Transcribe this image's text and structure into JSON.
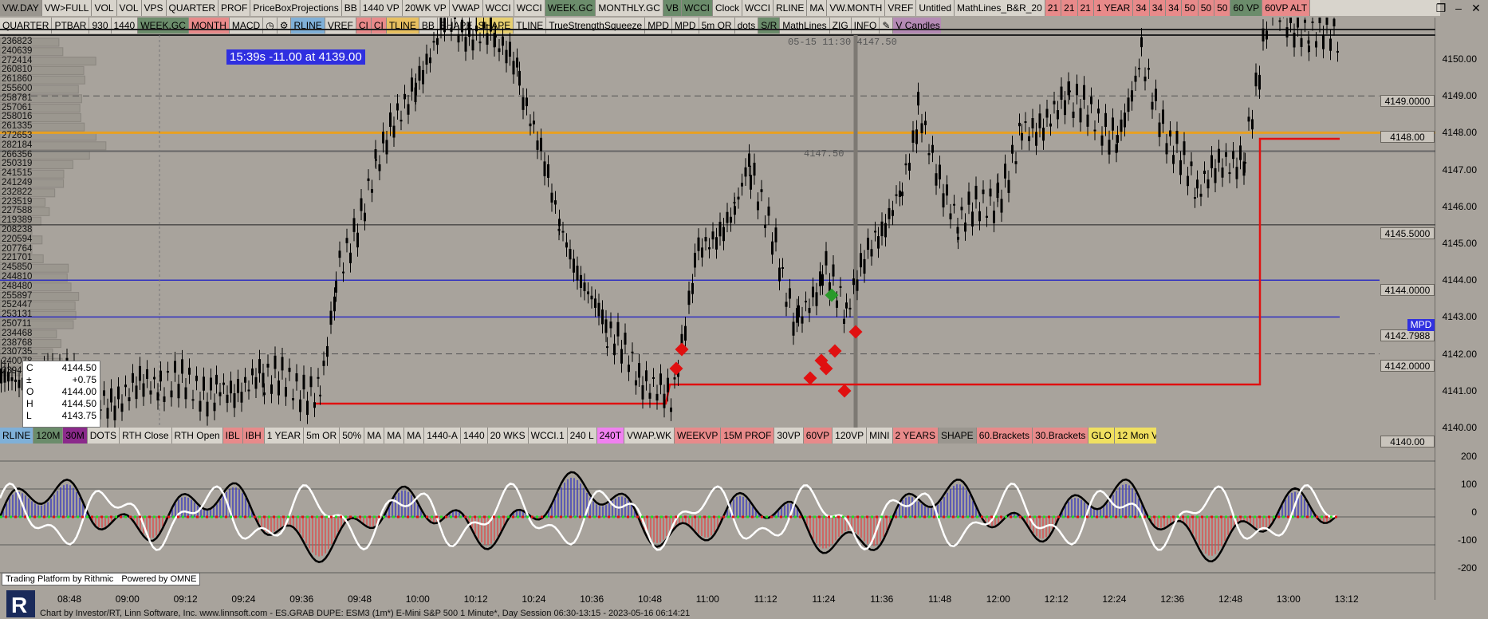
{
  "toolbar1": [
    {
      "label": "VW.DAY",
      "bg": "#9a968f"
    },
    {
      "label": "VW>FULL",
      "bg": "#d8d4cc"
    },
    {
      "label": "VOL",
      "bg": "#d8d4cc"
    },
    {
      "label": "VOL",
      "bg": "#d8d4cc"
    },
    {
      "label": "VPS",
      "bg": "#d8d4cc"
    },
    {
      "label": "QUARTER",
      "bg": "#d8d4cc"
    },
    {
      "label": "PROF",
      "bg": "#d8d4cc"
    },
    {
      "label": "PriceBoxProjections",
      "bg": "#d8d4cc"
    },
    {
      "label": "BB",
      "bg": "#d8d4cc"
    },
    {
      "label": "1440 VP",
      "bg": "#d8d4cc"
    },
    {
      "label": "20WK VP",
      "bg": "#d8d4cc"
    },
    {
      "label": "VWAP",
      "bg": "#d8d4cc"
    },
    {
      "label": "WCCI",
      "bg": "#d8d4cc"
    },
    {
      "label": "WCCI",
      "bg": "#d8d4cc"
    },
    {
      "label": "WEEK.GC",
      "bg": "#6b8c6b"
    },
    {
      "label": "MONTHLY.GC",
      "bg": "#d8d4cc"
    },
    {
      "label": "VB",
      "bg": "#6b8c6b"
    },
    {
      "label": "WCCI",
      "bg": "#6b8c6b"
    },
    {
      "label": "Clock",
      "bg": "#d8d4cc"
    },
    {
      "label": "WCCI",
      "bg": "#d8d4cc"
    },
    {
      "label": "RLINE",
      "bg": "#d8d4cc"
    },
    {
      "label": "MA",
      "bg": "#d8d4cc"
    },
    {
      "label": "VW.MONTH",
      "bg": "#d8d4cc"
    },
    {
      "label": "VREF",
      "bg": "#d8d4cc"
    },
    {
      "label": "Untitled",
      "bg": "#d8d4cc"
    },
    {
      "label": "MathLines_B&R_20",
      "bg": "#d8d4cc"
    },
    {
      "label": "21",
      "bg": "#e88a8a"
    },
    {
      "label": "21",
      "bg": "#e88a8a"
    },
    {
      "label": "21",
      "bg": "#e88a8a"
    },
    {
      "label": "1 YEAR",
      "bg": "#e88a8a"
    },
    {
      "label": "34",
      "bg": "#e88a8a"
    },
    {
      "label": "34",
      "bg": "#e88a8a"
    },
    {
      "label": "34",
      "bg": "#e88a8a"
    },
    {
      "label": "50",
      "bg": "#e88a8a"
    },
    {
      "label": "50",
      "bg": "#e88a8a"
    },
    {
      "label": "50",
      "bg": "#e88a8a"
    },
    {
      "label": "60 VP",
      "bg": "#6b8c6b"
    },
    {
      "label": "60VP ALT",
      "bg": "#e88a8a"
    }
  ],
  "toolbar2": [
    {
      "label": "QUARTER",
      "bg": "#d8d4cc"
    },
    {
      "label": "PTBAR",
      "bg": "#d8d4cc"
    },
    {
      "label": "930",
      "bg": "#d8d4cc"
    },
    {
      "label": "1440",
      "bg": "#d8d4cc"
    },
    {
      "label": "WEEK.GC",
      "bg": "#6b8c6b"
    },
    {
      "label": "MONTH",
      "bg": "#e88a8a"
    },
    {
      "label": "MACD",
      "bg": "#d8d4cc"
    },
    {
      "label": "◷",
      "bg": "#d8d4cc"
    },
    {
      "label": "⚙",
      "bg": "#d8d4cc"
    },
    {
      "label": "RLINE",
      "bg": "#7fb0d8"
    },
    {
      "label": "VREF",
      "bg": "#d8d4cc"
    },
    {
      "label": "CI",
      "bg": "#e88a8a"
    },
    {
      "label": "CI",
      "bg": "#e88a8a"
    },
    {
      "label": "TLINE",
      "bg": "#e8c060"
    },
    {
      "label": "BB",
      "bg": "#d8d4cc"
    },
    {
      "label": "SHAPE",
      "bg": "#d8d4cc"
    },
    {
      "label": "SHAPE",
      "bg": "#e8d070"
    },
    {
      "label": "TLINE",
      "bg": "#d8d4cc"
    },
    {
      "label": "TrueStrengthSqueeze",
      "bg": "#d8d4cc"
    },
    {
      "label": "MPD",
      "bg": "#d8d4cc"
    },
    {
      "label": "MPD",
      "bg": "#d8d4cc"
    },
    {
      "label": "5m OR",
      "bg": "#d8d4cc"
    },
    {
      "label": "dots",
      "bg": "#d8d4cc"
    },
    {
      "label": "S/R",
      "bg": "#6b8c6b"
    },
    {
      "label": "MathLines",
      "bg": "#d8d4cc"
    },
    {
      "label": "ZIG",
      "bg": "#d8d4cc"
    },
    {
      "label": "INFO",
      "bg": "#d8d4cc"
    },
    {
      "label": "✎",
      "bg": "#d8d4cc"
    },
    {
      "label": "V Candles ▾",
      "bg": "#b48ab4"
    }
  ],
  "toolbar3": [
    {
      "label": "RLINE",
      "bg": "#7fb0d8"
    },
    {
      "label": "120M",
      "bg": "#6b8c6b"
    },
    {
      "label": "30M",
      "bg": "#8b2a8b"
    },
    {
      "label": "DOTS",
      "bg": "#d8d4cc"
    },
    {
      "label": "RTH Close",
      "bg": "#d8d4cc"
    },
    {
      "label": "RTH Open",
      "bg": "#d8d4cc"
    },
    {
      "label": "IBL",
      "bg": "#e88a8a"
    },
    {
      "label": "IBH",
      "bg": "#e88a8a"
    },
    {
      "label": "1 YEAR",
      "bg": "#d8d4cc"
    },
    {
      "label": "5m OR",
      "bg": "#d8d4cc"
    },
    {
      "label": "50%",
      "bg": "#d8d4cc"
    },
    {
      "label": "MA",
      "bg": "#d8d4cc"
    },
    {
      "label": "MA",
      "bg": "#d8d4cc"
    },
    {
      "label": "MA",
      "bg": "#d8d4cc"
    },
    {
      "label": "1440-A",
      "bg": "#d8d4cc"
    },
    {
      "label": "1440",
      "bg": "#d8d4cc"
    },
    {
      "label": "20 WKS",
      "bg": "#d8d4cc"
    },
    {
      "label": "WCCI.1",
      "bg": "#d8d4cc"
    },
    {
      "label": "240 L",
      "bg": "#d8d4cc"
    },
    {
      "label": "240T",
      "bg": "#f080f0"
    },
    {
      "label": "VWAP.WK",
      "bg": "#d8d4cc"
    },
    {
      "label": "WEEKVP",
      "bg": "#e88a8a"
    },
    {
      "label": "15M PROF",
      "bg": "#e88a8a"
    },
    {
      "label": "30VP",
      "bg": "#d8d4cc"
    },
    {
      "label": "60VP",
      "bg": "#e88a8a"
    },
    {
      "label": "120VP",
      "bg": "#d8d4cc"
    },
    {
      "label": "MINI",
      "bg": "#d8d4cc"
    },
    {
      "label": "2 YEARS",
      "bg": "#e88a8a"
    },
    {
      "label": "SHAPE",
      "bg": "#9a968f"
    },
    {
      "label": "60.Brackets",
      "bg": "#e88a8a"
    },
    {
      "label": "30.Brackets",
      "bg": "#e88a8a"
    },
    {
      "label": "GLO",
      "bg": "#f0e060"
    },
    {
      "label": "12 Mon VP",
      "bg": "#f0e060"
    }
  ],
  "price_axis": [
    "4150.00",
    "4149.00",
    "4148.00",
    "4147.00",
    "4146.00",
    "4145.00",
    "4144.00",
    "4143.00",
    "4142.00",
    "4141.00",
    "4140.00"
  ],
  "osc_axis": [
    "200",
    "100",
    "0",
    "-100",
    "-200"
  ],
  "price_tags": [
    {
      "label": "4149.0000"
    },
    {
      "label": "4148.00"
    },
    {
      "label": "4145.5000"
    },
    {
      "label": "4144.0000"
    },
    {
      "label": "4142.7988"
    },
    {
      "label": "4142.0000"
    },
    {
      "label": "4140.00"
    }
  ],
  "mpd_label": "MPD",
  "volume_profile": [
    "236823",
    "240639",
    "272414",
    "260810",
    "261860",
    "255600",
    "258781",
    "257061",
    "258016",
    "261335",
    "272653",
    "282184",
    "266356",
    "250319",
    "241515",
    "241249",
    "232822",
    "223519",
    "227588",
    "219389",
    "208238",
    "220594",
    "207764",
    "221701",
    "245850",
    "244810",
    "248480",
    "255897",
    "252447",
    "253131",
    "250711",
    "234468",
    "238768",
    "230735",
    "240078",
    "239475"
  ],
  "badge_text": "15:39s  -11.00 at 4139.00",
  "crosshair_annot": "05-15 11:30  4147.50",
  "mid_annot": "4147.50",
  "info_box": [
    {
      "k": "C",
      "v": "4144.50"
    },
    {
      "k": "±",
      "v": "+0.75"
    },
    {
      "k": "O",
      "v": "4144.00"
    },
    {
      "k": "H",
      "v": "4144.50"
    },
    {
      "k": "L",
      "v": "4143.75"
    }
  ],
  "time_axis": [
    "08:48",
    "09:00",
    "09:12",
    "09:24",
    "09:36",
    "09:48",
    "10:00",
    "10:12",
    "10:24",
    "10:36",
    "10:48",
    "11:00",
    "11:12",
    "11:24",
    "11:36",
    "11:48",
    "12:00",
    "12:12",
    "12:24",
    "12:36",
    "12:48",
    "13:00",
    "13:12"
  ],
  "platform_left": "Trading Platform by Rithmic",
  "platform_right": "Powered by OMNE",
  "footer": "Chart by Investor/RT, Linn Software, Inc. www.linnsoft.com - ES.GRAB DUPE: ESM3 (1m*) E-Mini S&P 500 1 Minute*, Day Session 06:30-13:15 - 2023-05-16 06:14:21",
  "colors": {
    "bg": "#a8a39c",
    "orange": "#e8a020",
    "red": "#e01010",
    "blue": "#3030c0"
  }
}
